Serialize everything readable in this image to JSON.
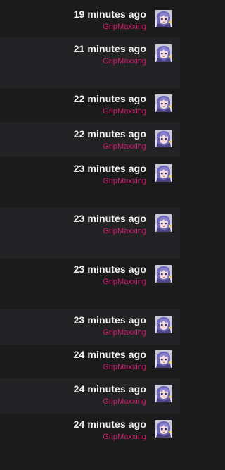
{
  "feed": {
    "entries": [
      {
        "time": "19 minutes ago",
        "user": "GripMaxxing"
      },
      {
        "time": "21 minutes ago",
        "user": "GripMaxxing"
      },
      {
        "time": "22 minutes ago",
        "user": "GripMaxxing"
      },
      {
        "time": "22 minutes ago",
        "user": "GripMaxxing"
      },
      {
        "time": "23 minutes ago",
        "user": "GripMaxxing"
      },
      {
        "time": "23 minutes ago",
        "user": "GripMaxxing"
      },
      {
        "time": "23 minutes ago",
        "user": "GripMaxxing"
      },
      {
        "time": "23 minutes ago",
        "user": "GripMaxxing"
      },
      {
        "time": "24 minutes ago",
        "user": "GripMaxxing"
      },
      {
        "time": "24 minutes ago",
        "user": "GripMaxxing"
      },
      {
        "time": "24 minutes ago",
        "user": "GripMaxxing"
      }
    ],
    "avatar_icon": "anime-avatar-icon"
  },
  "colors": {
    "background": "#1b1b1c",
    "row_alt": "#232325",
    "time_text": "#f2f2f2",
    "username": "#d31f6e"
  }
}
